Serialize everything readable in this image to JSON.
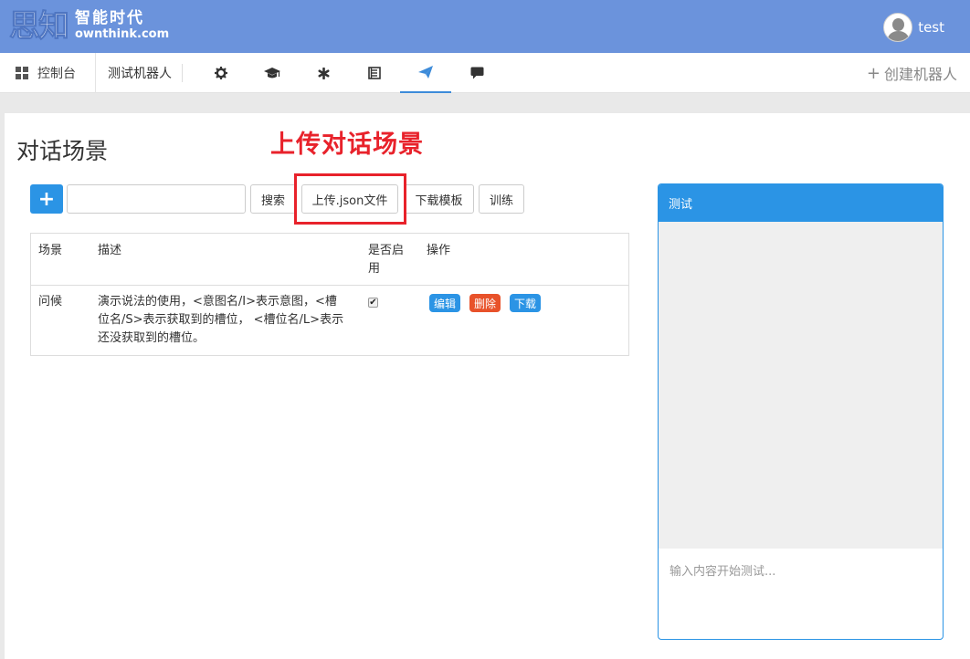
{
  "header": {
    "logo_mark": "思知",
    "logo_cn": "智能时代",
    "logo_en": "ownthink.com",
    "username": "test"
  },
  "nav": {
    "dashboard_label": "控制台",
    "robot_label": "测试机器人",
    "icons": [
      "gear-icon",
      "graduation-cap-icon",
      "asterisk-icon",
      "book-icon",
      "send-icon",
      "comment-icon"
    ],
    "create_label": "创建机器人"
  },
  "page": {
    "title": "对话场景",
    "annotation": "上传对话场景"
  },
  "toolbar": {
    "add_label": "+",
    "search_value": "",
    "search_button": "搜索",
    "upload_button": "上传.json文件",
    "download_template_button": "下载模板",
    "train_button": "训练"
  },
  "table": {
    "headers": [
      "场景",
      "描述",
      "是否启用",
      "操作"
    ],
    "rows": [
      {
        "scene": "问候",
        "desc_line1": "演示说法的使用，<意图名/I>表示意图，<槽",
        "desc_line2": "位名/S>表示获取到的槽位，  <槽位名/L>表示",
        "desc_line3": "还没获取到的槽位。",
        "enabled": true,
        "actions": [
          "编辑",
          "删除",
          "下载"
        ]
      }
    ]
  },
  "test_panel": {
    "title": "测试",
    "placeholder": "输入内容开始测试..."
  },
  "colors": {
    "header_bg": "#6b93dc",
    "primary": "#2b94e5",
    "danger": "#e8522a",
    "annotation": "#e8222b"
  }
}
